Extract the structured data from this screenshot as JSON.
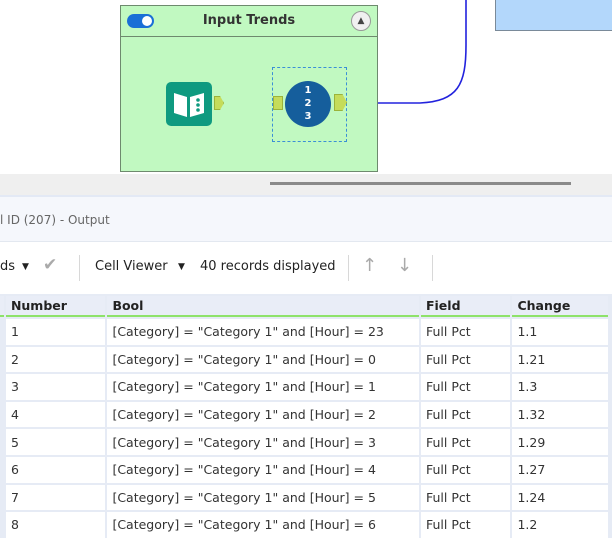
{
  "canvas": {
    "container_title": "Input Trends",
    "tool_numbers": [
      "1",
      "2",
      "3"
    ]
  },
  "output": {
    "title": "l ID (207) - Output",
    "toolbar": {
      "records_dropdown": "ds",
      "cell_viewer": "Cell Viewer",
      "records_count": "40 records displayed"
    }
  },
  "table": {
    "columns": [
      "Number",
      "Bool",
      "Field",
      "Change"
    ],
    "rows": [
      [
        "1",
        "[Category] = \"Category 1\" and [Hour] = 23",
        "Full Pct",
        "1.1"
      ],
      [
        "2",
        "[Category] = \"Category 1\" and [Hour] = 0",
        "Full Pct",
        "1.21"
      ],
      [
        "3",
        "[Category] = \"Category 1\" and [Hour] = 1",
        "Full Pct",
        "1.3"
      ],
      [
        "4",
        "[Category] = \"Category 1\" and [Hour] = 2",
        "Full Pct",
        "1.32"
      ],
      [
        "5",
        "[Category] = \"Category 1\" and [Hour] = 3",
        "Full Pct",
        "1.29"
      ],
      [
        "6",
        "[Category] = \"Category 1\" and [Hour] = 4",
        "Full Pct",
        "1.27"
      ],
      [
        "7",
        "[Category] = \"Category 1\" and [Hour] = 5",
        "Full Pct",
        "1.24"
      ],
      [
        "8",
        "[Category] = \"Category 1\" and [Hour] = 6",
        "Full Pct",
        "1.2"
      ]
    ]
  }
}
